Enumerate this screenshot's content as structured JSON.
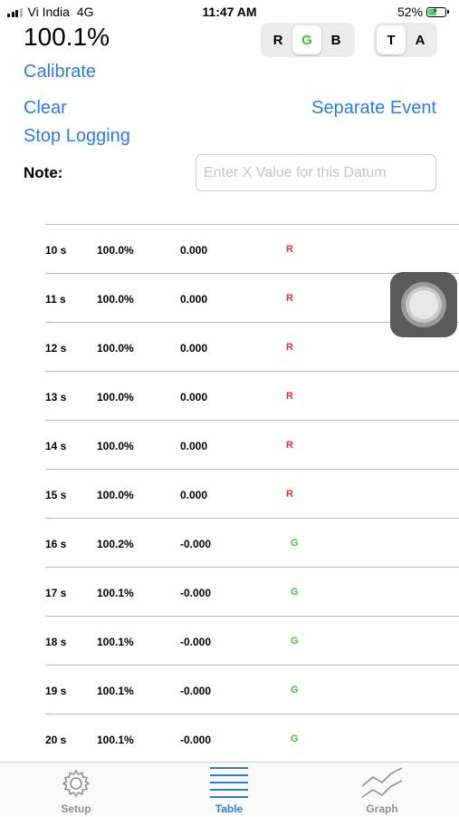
{
  "status_bar": {
    "carrier": "Vi India",
    "network": "4G",
    "time": "11:47 AM",
    "battery_percent": "52%",
    "battery_level": 0.52
  },
  "header": {
    "reading": "100.1%",
    "calibrate_label": "Calibrate",
    "clear_label": "Clear",
    "separate_event_label": "Separate Event",
    "stop_logging_label": "Stop Logging"
  },
  "color_segment": {
    "options": [
      "R",
      "G",
      "B"
    ],
    "selected": "G"
  },
  "mode_segment": {
    "options": [
      "T",
      "A"
    ],
    "selected": "T"
  },
  "note": {
    "label": "Note:",
    "placeholder": "Enter X Value for this Datum",
    "value": ""
  },
  "table": {
    "rows": [
      {
        "time": "10 s",
        "percent": "100.0%",
        "value": "0.000",
        "channel": "R"
      },
      {
        "time": "11 s",
        "percent": "100.0%",
        "value": "0.000",
        "channel": "R"
      },
      {
        "time": "12 s",
        "percent": "100.0%",
        "value": "0.000",
        "channel": "R"
      },
      {
        "time": "13 s",
        "percent": "100.0%",
        "value": "0.000",
        "channel": "R"
      },
      {
        "time": "14 s",
        "percent": "100.0%",
        "value": "0.000",
        "channel": "R"
      },
      {
        "time": "15 s",
        "percent": "100.0%",
        "value": "0.000",
        "channel": "R"
      },
      {
        "time": "16 s",
        "percent": "100.2%",
        "value": "-0.000",
        "channel": "G"
      },
      {
        "time": "17 s",
        "percent": "100.1%",
        "value": "-0.000",
        "channel": "G"
      },
      {
        "time": "18 s",
        "percent": "100.1%",
        "value": "-0.000",
        "channel": "G"
      },
      {
        "time": "19 s",
        "percent": "100.1%",
        "value": "-0.000",
        "channel": "G"
      },
      {
        "time": "20 s",
        "percent": "100.1%",
        "value": "-0.000",
        "channel": "G"
      }
    ]
  },
  "tab_bar": {
    "tabs": [
      {
        "label": "Setup",
        "icon": "gear-icon"
      },
      {
        "label": "Table",
        "icon": "table-lines-icon"
      },
      {
        "label": "Graph",
        "icon": "graph-icon"
      }
    ],
    "active": "Table"
  },
  "colors": {
    "accent": "#2f7be0",
    "red_channel": "#e0312f",
    "green_channel": "#3cc43c",
    "inactive_tab": "#8e8e8e"
  }
}
